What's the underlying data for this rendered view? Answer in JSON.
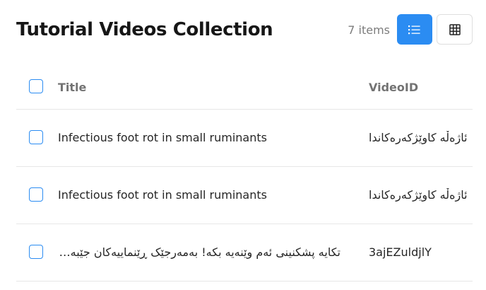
{
  "header": {
    "title": "Tutorial Videos Collection",
    "item_count": "7 items",
    "list_view_icon": "list-icon",
    "grid_view_icon": "grid-icon",
    "active_view": "list"
  },
  "table": {
    "columns": [
      {
        "label": "Title"
      },
      {
        "label": "VideoID"
      }
    ],
    "rows": [
      {
        "title": "Infectious foot rot in small ruminants",
        "video_id": "ئاژەڵە کاوێژکەرەکاندا"
      },
      {
        "title": "Infectious foot rot in small ruminants",
        "video_id": "ئاژەڵە کاوێژکەرەکاندا"
      },
      {
        "title": "تکایە پشکنینی ئەم وێنەیە بکە! بەمەرجێک ڕێنماییەکان جێبەجێ بکە و زیاتر زانیاری بەدەست بهێنە. تکایە ئەم پێویستییە پڕبکەرەوە و یارمەتیمان بدە بە هەڵەکانت لە پڕۆسەکەدا! گوێگرتن لەم پەیامە زۆر گرنگە بۆ هەموو بەکارهێنەران بۆیە گۆڕانکارییەکان بکە بۆ باشترکردنی کارەکان. بەشداربووان تکایە پێشکەش بکەن بە هەموو شێوەیەک لە کاتی گونجاودا بۆ ئەوەی کێشەکان چارەسەر بکرێن بە باشی و بە خێرایی. ئەم ڕێکارانە پەیڕەو بکە بۆ ئەوەی هەڵەکان نەمێنن و لە کۆتاییدا ئەنجامێکی باش بەدەست بهێنرێت. هەڵەکان بڕۆنەوە بە هەڵکەوتی باش ئەوە زۆر گرنگە بۆ ئێمە و هەموو خەڵک دواتر پەیامێکیش بنێرە بۆ ئێمە ئەگەر پێویستت بە یارمەتی هەبوو لە پاش کۆتاییهێنانی کارەکە ئاگادارمان بکەرەوە. خۆشحاڵ دەبین بە یارمەتیدانت لە هەر کاتێکدا لەسەر هەر پرسیارێک و تێبینیەک یان پێشنیارێک کە هەتبێت لەبارەی وێنەکانەوە یان هەر شتێکی تر. دڵنیابە لە خوێندنەوەی تەواوی ڕێنماییەکان پێش دەستپێکردن بە کارەکە و ئەگەر هەر پرسیارێکت هەبوو پەیوەندیمان پێوە بکە. سوپاس بۆ هاوکاریت. هەڵکەوتی باش و پشکنینێکی سەرکەوتوو! لەگەڵ ڕێزدا، تیمی پشتگیری. ئێمە لێرەین بۆ یارمەتیدانت لە هەر کاتێکدا. ئومێدەوارین ئەزموونێکی باشت هەبێت لەگەڵ ئێمەدا. هەڵەکان بنووسە و پاشان بۆمان بنێرە تاکو بتوانین چاکیان بکەینەوە. زۆر سوپاس. ئەگەر هەڵەیەکت بینی تکایە ئاگادارمان بکەرەوە بۆ ئەوەی چاکی بکەینەوە. سوپاس بۆ کاتەکەت. هیوادارم ڕۆژێکی خۆشت بێت. تکایە ئەم هەڵەیە چاکبکە بە زووترین کات. ئەگەر پێویستت بە هەر یارمەتییەک هەبوو، تکایە پەیوەندیمان پێوە بکە. هەڵەکە گلەیمان لێبکە! بەمەرجێک ڕێنماییەکان جێبەجێ بکە",
        "video_id": "3ajEZuldjlY"
      }
    ]
  }
}
